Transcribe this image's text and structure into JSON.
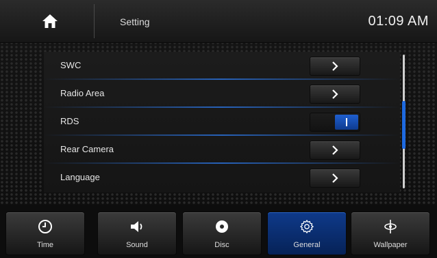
{
  "header": {
    "title": "Setting",
    "clock": "01:09 AM"
  },
  "settings": {
    "items": [
      {
        "label": "SWC",
        "control": "arrow"
      },
      {
        "label": "Radio Area",
        "control": "arrow"
      },
      {
        "label": "RDS",
        "control": "toggle",
        "on": true
      },
      {
        "label": "Rear Camera",
        "control": "arrow"
      },
      {
        "label": "Language",
        "control": "arrow"
      }
    ]
  },
  "nav": {
    "items": [
      {
        "label": "Time",
        "icon": "clock-icon"
      },
      {
        "label": "Sound",
        "icon": "speaker-icon"
      },
      {
        "label": "Disc",
        "icon": "disc-icon"
      },
      {
        "label": "General",
        "icon": "gear-icon",
        "active": true
      },
      {
        "label": "Wallpaper",
        "icon": "wallpaper-icon"
      }
    ]
  },
  "colors": {
    "accent": "#1e6ae0",
    "active_nav": "#0f3a8a"
  }
}
